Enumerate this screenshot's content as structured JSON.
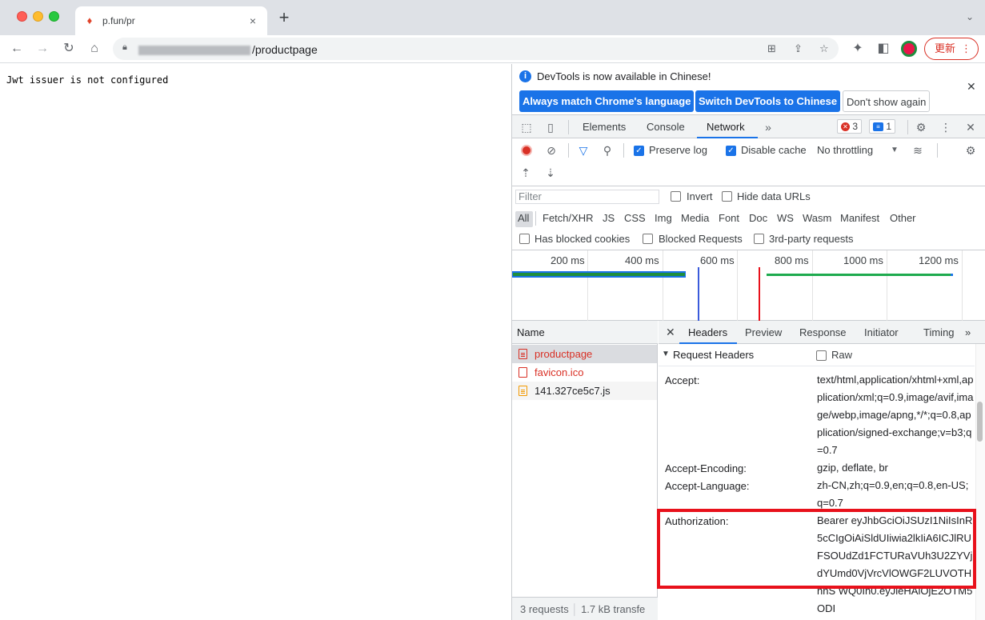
{
  "browser": {
    "tab_title": "p.fun/pr",
    "url_visible_suffix": "/productpage",
    "update_button": "更新"
  },
  "page": {
    "message": "Jwt issuer is not configured"
  },
  "devtools": {
    "infobar": {
      "message": "DevTools is now available in Chinese!",
      "btn_match": "Always match Chrome's language",
      "btn_switch": "Switch DevTools to Chinese",
      "btn_dont_show": "Don't show again"
    },
    "tabs": [
      "Elements",
      "Console",
      "Network"
    ],
    "active_tab": "Network",
    "error_count": "3",
    "message_count": "1",
    "network_toolbar": {
      "preserve_log": "Preserve log",
      "disable_cache": "Disable cache",
      "throttling": "No throttling"
    },
    "filter": {
      "placeholder": "Filter",
      "invert": "Invert",
      "hide_data_urls": "Hide data URLs",
      "types": [
        "All",
        "Fetch/XHR",
        "JS",
        "CSS",
        "Img",
        "Media",
        "Font",
        "Doc",
        "WS",
        "Wasm",
        "Manifest",
        "Other"
      ],
      "has_blocked_cookies": "Has blocked cookies",
      "blocked_requests": "Blocked Requests",
      "third_party": "3rd-party requests"
    },
    "timeline": {
      "ticks": [
        "200 ms",
        "400 ms",
        "600 ms",
        "800 ms",
        "1000 ms",
        "1200 ms"
      ]
    },
    "requests": {
      "header": "Name",
      "items": [
        {
          "name": "productpage",
          "status": "error"
        },
        {
          "name": "favicon.ico",
          "status": "error"
        },
        {
          "name": "141.327ce5c7.js",
          "status": "ok"
        }
      ],
      "footer_count": "3 requests",
      "footer_size": "1.7 kB transfe"
    },
    "detail": {
      "tabs": [
        "Headers",
        "Preview",
        "Response",
        "Initiator",
        "Timing"
      ],
      "active_tab": "Headers",
      "section_title": "Request Headers",
      "raw_label": "Raw",
      "headers": [
        {
          "name": "Accept:",
          "value": "text/html,application/xhtml+xml,application/xml;q=0.9,image/avif,image/webp,image/apng,*/*;q=0.8,application/signed-exchange;v=b3;q=0.7"
        },
        {
          "name": "Accept-Encoding:",
          "value": "gzip, deflate, br"
        },
        {
          "name": "Accept-Language:",
          "value": "zh-CN,zh;q=0.9,en;q=0.8,en-US;q=0.7"
        },
        {
          "name": "Authorization:",
          "value": "Bearer eyJhbGciOiJSUzI1NiIsInR5cCIgOiAiSldUIiwia2lkIiA6ICJlRUFSOUdZd1FCTURaVUh3U2ZYVjdYUmd0VjVrcVlOWGF2LUVOTHhhS WQ0In0.eyJleHAiOjE2OTM5ODI"
        }
      ]
    }
  }
}
